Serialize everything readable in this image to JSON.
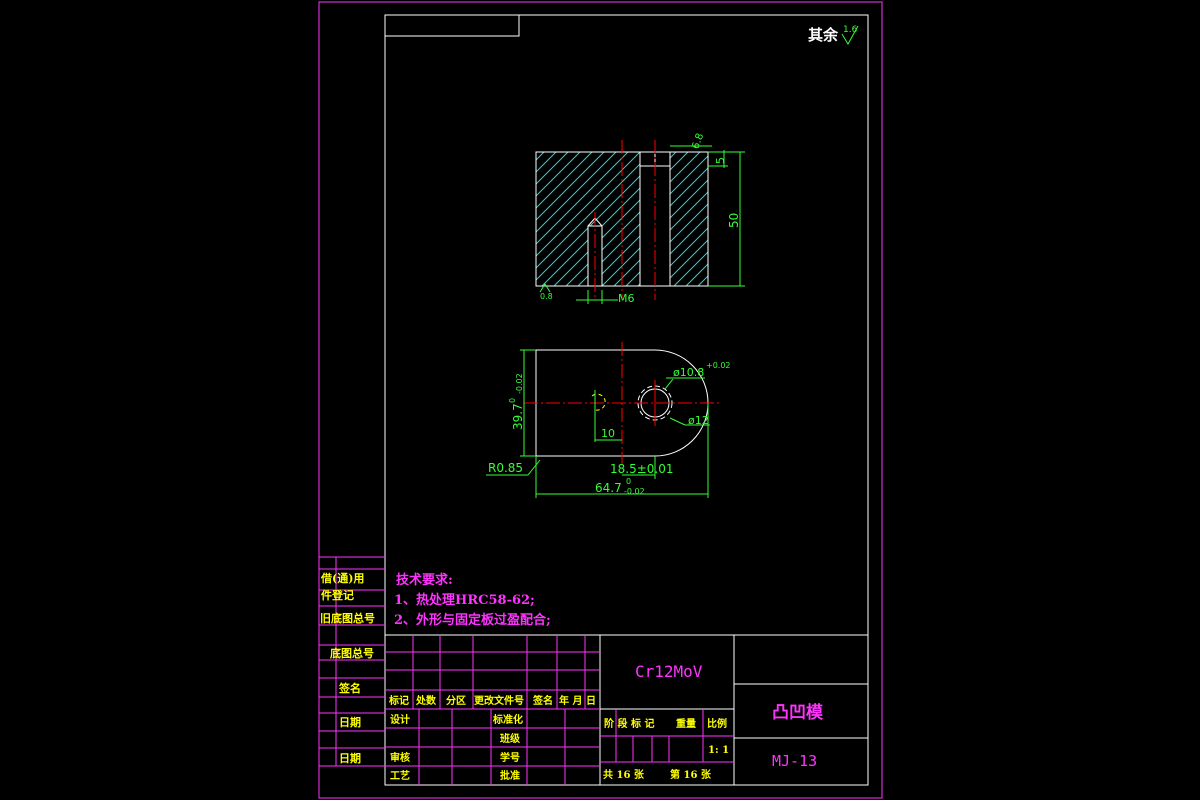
{
  "roughness": {
    "label": "其余",
    "value": "1.6"
  },
  "section_view": {
    "dim_hole_dia": "6.8",
    "dim_counterbore_depth": "5",
    "dim_height": "50",
    "dim_thread": "M6",
    "roughness_bottom": "0.8"
  },
  "plan_view": {
    "dim_hole_dia": "ø10.8",
    "dim_hole_tol": "+0.02",
    "dim_counterbore": "ø12",
    "dim_width": "39.7",
    "dim_width_tol_upper": "0",
    "dim_width_tol_lower": "-0.02",
    "dim_offset": "10",
    "dim_radius": "R0.85",
    "dim_center": "18.5±0.01",
    "dim_length": "64.7",
    "dim_length_tol_upper": "0",
    "dim_length_tol_lower": "-0.02"
  },
  "side_labels": [
    "借(通)用",
    "件登记",
    "旧底图总号",
    "底图总号",
    "签名",
    "日期",
    "日期"
  ],
  "tech_requirements": {
    "title": "技术要求:",
    "item1": "1、热处理HRC58-62;",
    "item2": "2、外形与固定板过盈配合;"
  },
  "title_block": {
    "material": "Cr12MoV",
    "part_name": "凸凹模",
    "drawing_no": "MJ-13",
    "rev_headers": [
      "标记",
      "处数",
      "分区",
      "更改文件号",
      "签名",
      "年 月 日"
    ],
    "row_design": "设计",
    "row_standard": "标准化",
    "row_class": "班级",
    "row_check": "审核",
    "row_id": "学号",
    "row_process": "工艺",
    "row_approve": "批准",
    "stage_headers": [
      "阶 段 标 记",
      "重量",
      "比例"
    ],
    "scale": "1: 1",
    "total_sheets": "共 16 张",
    "sheet_no": "第 16 张"
  }
}
